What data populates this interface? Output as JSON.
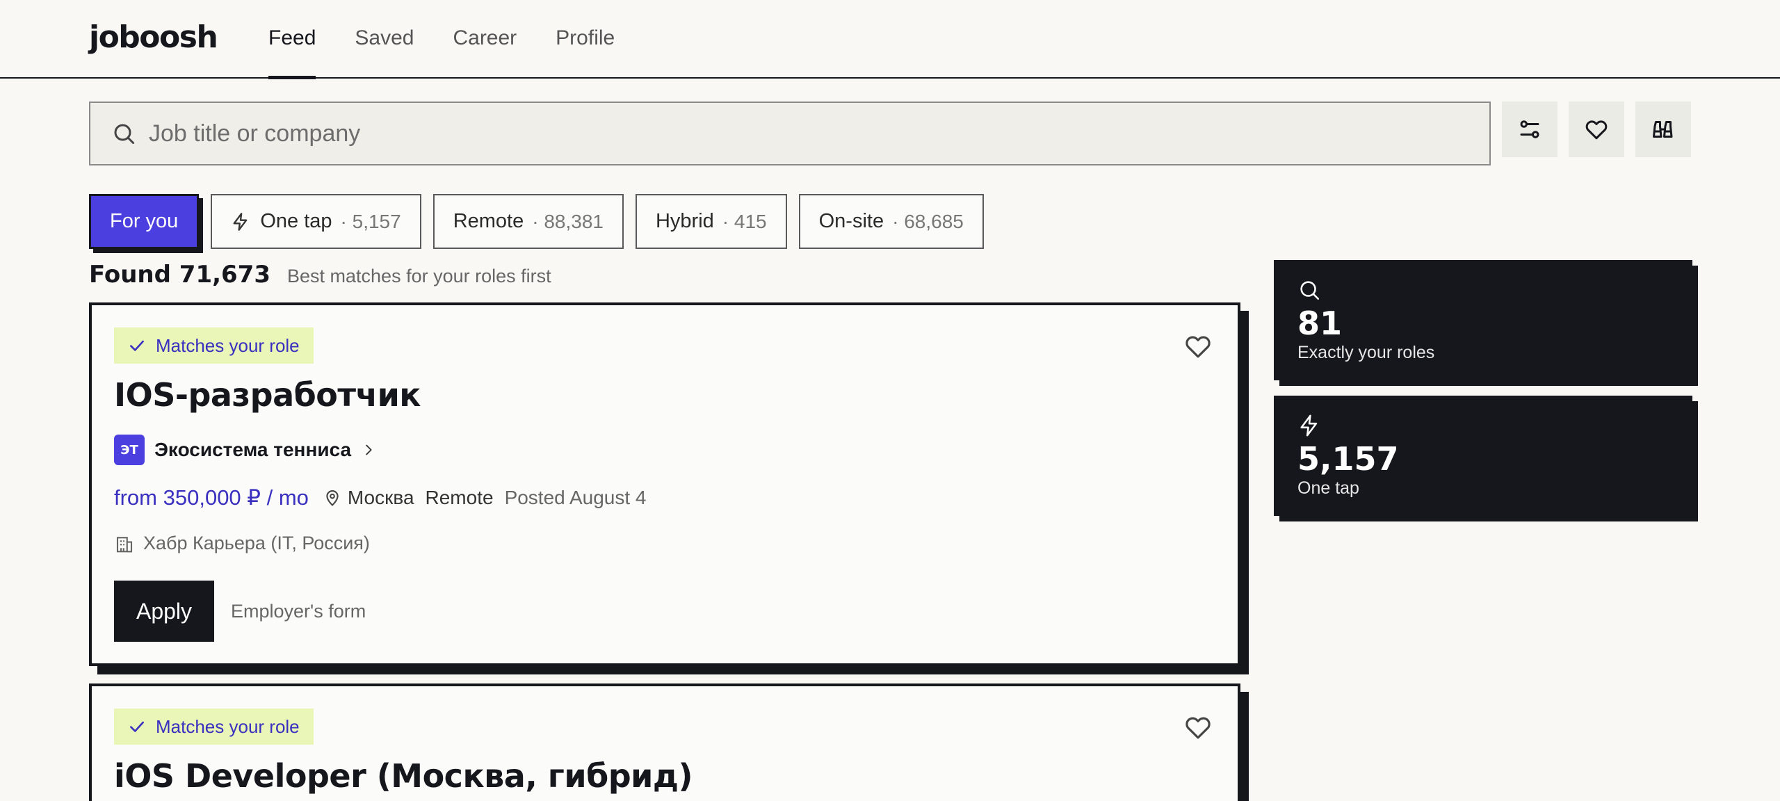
{
  "app": {
    "logo": "joboosh"
  },
  "nav": {
    "items": [
      "Feed",
      "Saved",
      "Career",
      "Profile"
    ],
    "active": "Feed"
  },
  "search": {
    "placeholder": "Job title or company"
  },
  "chips": [
    {
      "label": "For you",
      "count": "",
      "active": true
    },
    {
      "label": "One tap",
      "count": "· 5,157",
      "icon": "bolt-icon"
    },
    {
      "label": "Remote",
      "count": "· 88,381"
    },
    {
      "label": "Hybrid",
      "count": "· 415"
    },
    {
      "label": "On-site",
      "count": "· 68,685"
    }
  ],
  "results": {
    "found": "Found 71,673",
    "subtitle": "Best matches for your roles first"
  },
  "jobs": [
    {
      "badge": "Matches your role",
      "title": "IOS-разработчик",
      "company_initials": "ЭТ",
      "company": "Экосистема тенниса",
      "salary": "from 350,000 ₽ / mo",
      "location": "Москва",
      "format": "Remote",
      "posted": "Posted August 4",
      "source": "Хабр Карьера (IT, Россия)",
      "apply_label": "Apply",
      "apply_note": "Employer's form"
    },
    {
      "badge": "Matches your role",
      "title": "iOS Developer (Москва, гибрид)"
    }
  ],
  "stats": [
    {
      "icon": "search-icon",
      "value": "81",
      "label": "Exactly your roles"
    },
    {
      "icon": "bolt-icon",
      "value": "5,157",
      "label": "One tap"
    }
  ],
  "colors": {
    "accent": "#4b3fe0",
    "dark": "#16161d",
    "badge_bg": "#eaf6b8"
  }
}
